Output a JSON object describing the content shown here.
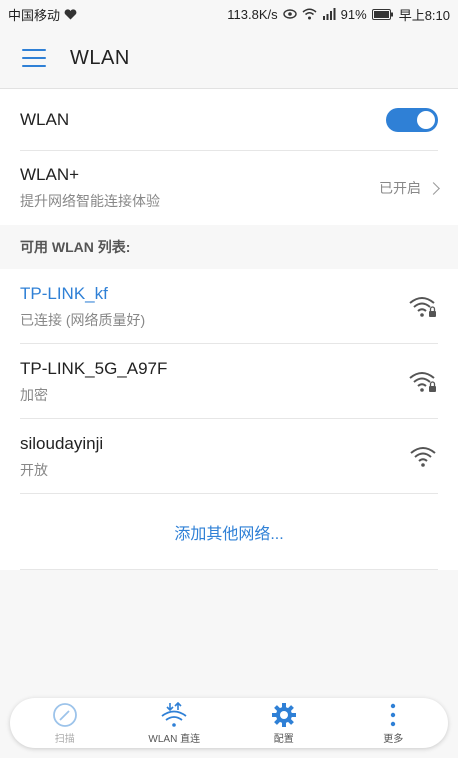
{
  "status_bar": {
    "carrier": "中国移动",
    "speed": "113.8K/s",
    "battery_percent": "91%",
    "time": "早上8:10"
  },
  "app_bar": {
    "title": "WLAN"
  },
  "wlan_toggle": {
    "label": "WLAN",
    "on": true
  },
  "wlan_plus": {
    "label": "WLAN+",
    "description": "提升网络智能连接体验",
    "status": "已开启"
  },
  "list_header": "可用 WLAN 列表:",
  "networks": [
    {
      "name": "TP-LINK_kf",
      "status": "已连接 (网络质量好)",
      "secured": true,
      "connected": true
    },
    {
      "name": "TP-LINK_5G_A97F",
      "status": "加密",
      "secured": true,
      "connected": false
    },
    {
      "name": "siloudayinji",
      "status": "开放",
      "secured": false,
      "connected": false
    }
  ],
  "add_network": "添加其他网络...",
  "bottom_nav": [
    {
      "label": "扫描",
      "icon": "scan-icon",
      "enabled": false
    },
    {
      "label": "WLAN 直连",
      "icon": "wlan-direct-icon",
      "enabled": true
    },
    {
      "label": "配置",
      "icon": "settings-gear-icon",
      "enabled": true
    },
    {
      "label": "更多",
      "icon": "more-dots-icon",
      "enabled": true
    }
  ],
  "colors": {
    "accent": "#2f80d6",
    "background": "#f7f7f7"
  }
}
